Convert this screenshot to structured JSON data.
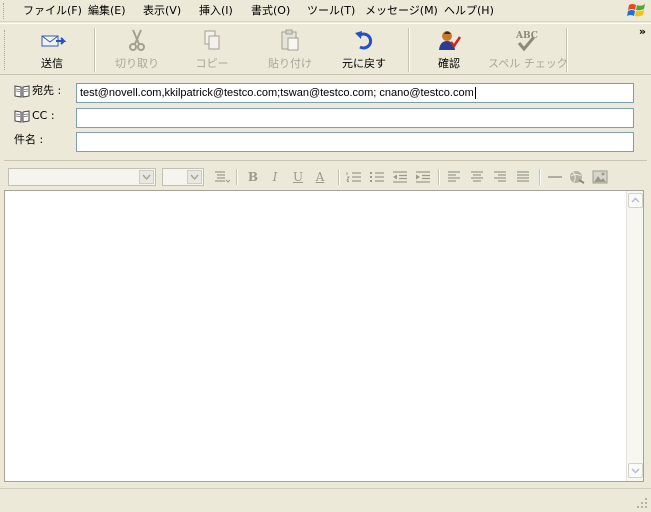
{
  "menubar": {
    "items": [
      "ファイル(F)",
      "編集(E)",
      "表示(V)",
      "挿入(I)",
      "書式(O)",
      "ツール(T)",
      "メッセージ(M)",
      "ヘルプ(H)"
    ]
  },
  "toolbar": {
    "send": "送信",
    "cut": "切り取り",
    "copy": "コピー",
    "paste": "貼り付け",
    "undo": "元に戻す",
    "check": "確認",
    "spell": "スペル チェック",
    "spell_icon_text": "ABC",
    "overflow": "»"
  },
  "header": {
    "to_label": "宛先 :",
    "to_value": "test@novell.com,kkilpatrick@testco.com;tswan@testco.com; cnano@testco.com",
    "cc_label": "CC :",
    "cc_value": "",
    "subject_label": "件名 :",
    "subject_value": ""
  },
  "formatbar": {
    "font_name": "",
    "font_size": "",
    "bold": "B",
    "italic": "I",
    "underline": "U",
    "font_color": "A"
  },
  "body": {
    "text": ""
  },
  "colors": {
    "chrome": "#ece9d8",
    "field_border": "#7f9db9",
    "disabled_text": "#aca899",
    "accent_blue": "#2450c8"
  }
}
